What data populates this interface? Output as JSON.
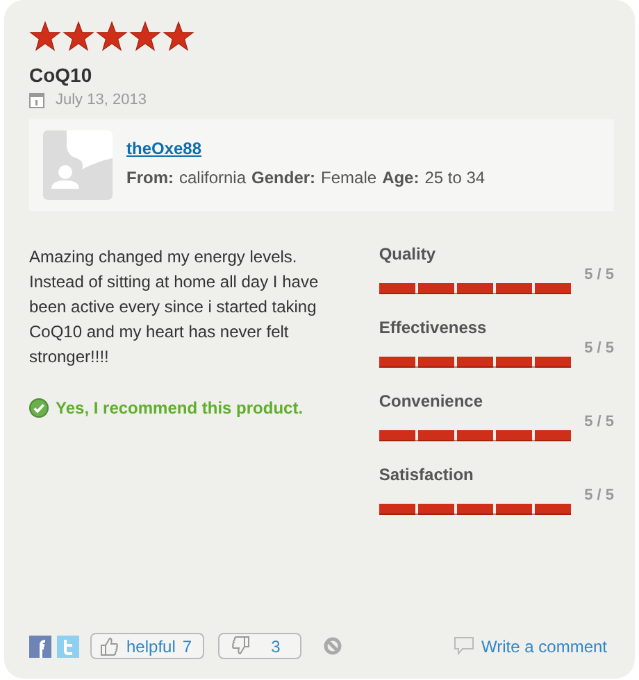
{
  "review": {
    "stars": 5,
    "title": "CoQ10",
    "date": "July 13, 2013",
    "reviewer": {
      "name": "theOxe88",
      "fields": [
        {
          "label": "From:",
          "value": "california"
        },
        {
          "label": "Gender:",
          "value": "Female"
        },
        {
          "label": "Age:",
          "value": "25 to 34"
        }
      ]
    },
    "body": "Amazing changed my energy levels. Instead of sitting at home all day I have been active every since i started taking CoQ10 and my heart has never felt stronger!!!!",
    "recommend": "Yes, I recommend this product.",
    "ratings": [
      {
        "label": "Quality",
        "level": 1,
        "reading": "5 / 5"
      },
      {
        "label": "Effectiveness",
        "level": 1,
        "reading": "5 / 5"
      },
      {
        "label": "Convenience",
        "level": 1,
        "reading": "5 / 5"
      },
      {
        "label": "Satisfaction",
        "level": 1,
        "reading": "5 / 5"
      }
    ]
  },
  "footer": {
    "helpful": {
      "label": "helpful",
      "count": "7"
    },
    "unhelpful": {
      "count": "3"
    },
    "comment": "Write a comment"
  }
}
